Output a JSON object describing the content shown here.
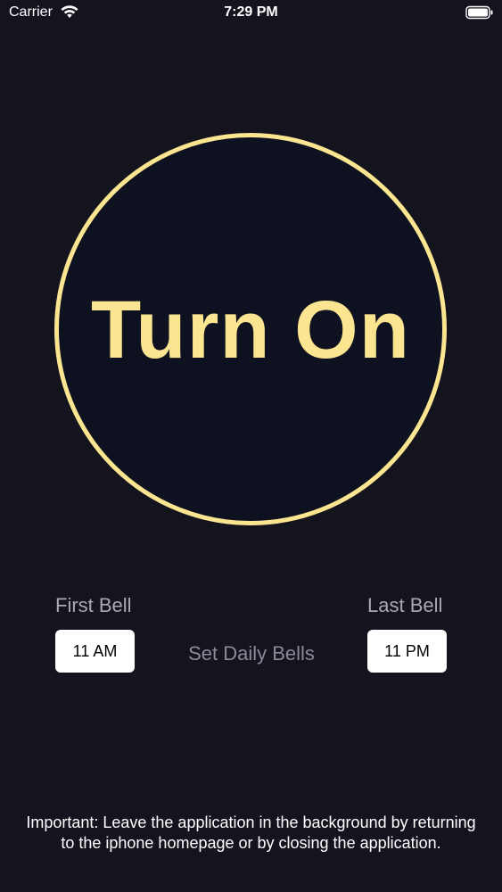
{
  "status_bar": {
    "carrier": "Carrier",
    "time": "7:29 PM",
    "wifi_icon": "wifi-icon",
    "battery_icon": "battery-icon"
  },
  "power_button": {
    "label": "Turn On",
    "accent_color": "#fbe590"
  },
  "bells": {
    "first_label": "First Bell",
    "first_time": "11 AM",
    "last_label": "Last Bell",
    "last_time": "11 PM",
    "set_label": "Set Daily Bells"
  },
  "notice": {
    "text": "Important: Leave the application in the background by returning to the iphone homepage or by closing the application."
  },
  "colors": {
    "background": "#14141f",
    "accent": "#fbe590",
    "muted_text": "#a9a9b4"
  }
}
